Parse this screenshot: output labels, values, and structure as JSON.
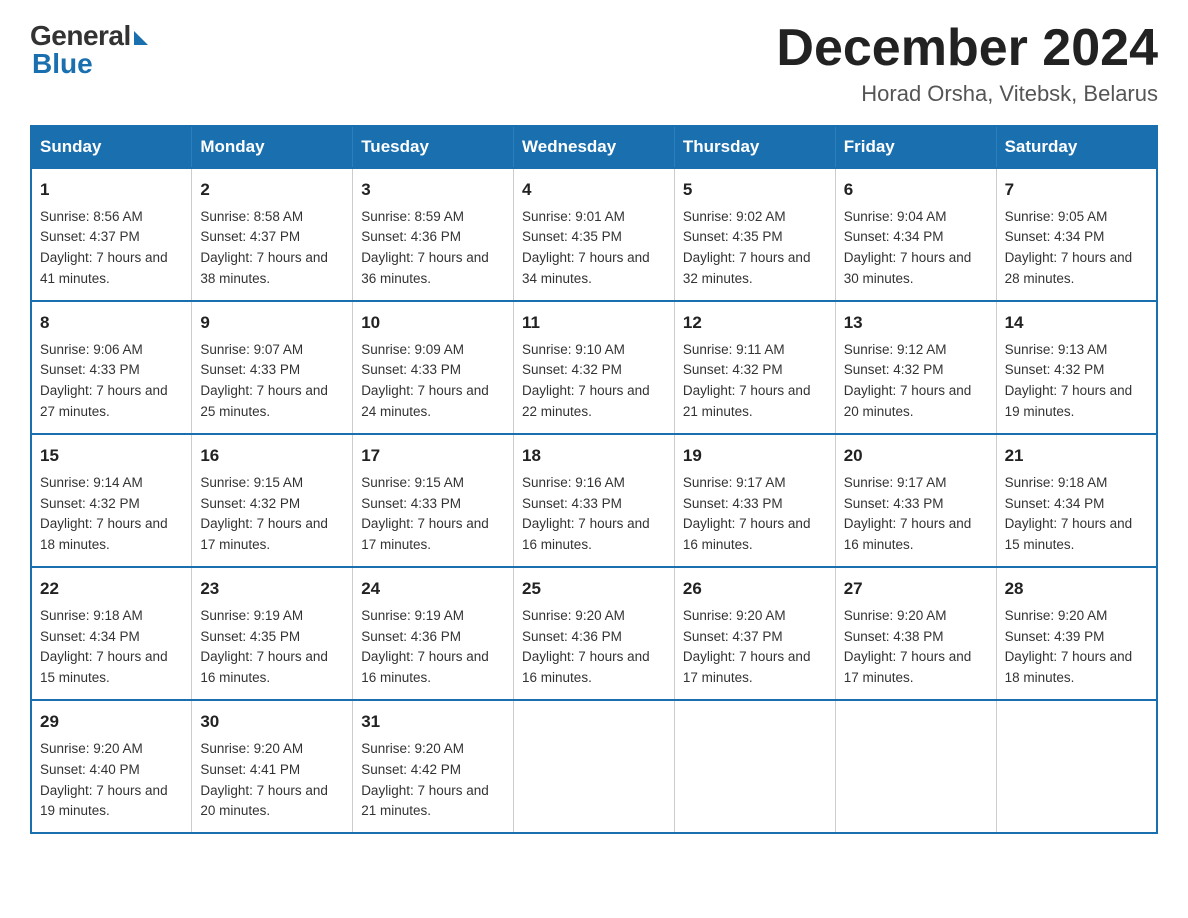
{
  "header": {
    "logo_general": "General",
    "logo_blue": "Blue",
    "month_title": "December 2024",
    "subtitle": "Horad Orsha, Vitebsk, Belarus"
  },
  "weekdays": [
    "Sunday",
    "Monday",
    "Tuesday",
    "Wednesday",
    "Thursday",
    "Friday",
    "Saturday"
  ],
  "weeks": [
    [
      {
        "day": "1",
        "sunrise": "8:56 AM",
        "sunset": "4:37 PM",
        "daylight": "7 hours and 41 minutes."
      },
      {
        "day": "2",
        "sunrise": "8:58 AM",
        "sunset": "4:37 PM",
        "daylight": "7 hours and 38 minutes."
      },
      {
        "day": "3",
        "sunrise": "8:59 AM",
        "sunset": "4:36 PM",
        "daylight": "7 hours and 36 minutes."
      },
      {
        "day": "4",
        "sunrise": "9:01 AM",
        "sunset": "4:35 PM",
        "daylight": "7 hours and 34 minutes."
      },
      {
        "day": "5",
        "sunrise": "9:02 AM",
        "sunset": "4:35 PM",
        "daylight": "7 hours and 32 minutes."
      },
      {
        "day": "6",
        "sunrise": "9:04 AM",
        "sunset": "4:34 PM",
        "daylight": "7 hours and 30 minutes."
      },
      {
        "day": "7",
        "sunrise": "9:05 AM",
        "sunset": "4:34 PM",
        "daylight": "7 hours and 28 minutes."
      }
    ],
    [
      {
        "day": "8",
        "sunrise": "9:06 AM",
        "sunset": "4:33 PM",
        "daylight": "7 hours and 27 minutes."
      },
      {
        "day": "9",
        "sunrise": "9:07 AM",
        "sunset": "4:33 PM",
        "daylight": "7 hours and 25 minutes."
      },
      {
        "day": "10",
        "sunrise": "9:09 AM",
        "sunset": "4:33 PM",
        "daylight": "7 hours and 24 minutes."
      },
      {
        "day": "11",
        "sunrise": "9:10 AM",
        "sunset": "4:32 PM",
        "daylight": "7 hours and 22 minutes."
      },
      {
        "day": "12",
        "sunrise": "9:11 AM",
        "sunset": "4:32 PM",
        "daylight": "7 hours and 21 minutes."
      },
      {
        "day": "13",
        "sunrise": "9:12 AM",
        "sunset": "4:32 PM",
        "daylight": "7 hours and 20 minutes."
      },
      {
        "day": "14",
        "sunrise": "9:13 AM",
        "sunset": "4:32 PM",
        "daylight": "7 hours and 19 minutes."
      }
    ],
    [
      {
        "day": "15",
        "sunrise": "9:14 AM",
        "sunset": "4:32 PM",
        "daylight": "7 hours and 18 minutes."
      },
      {
        "day": "16",
        "sunrise": "9:15 AM",
        "sunset": "4:32 PM",
        "daylight": "7 hours and 17 minutes."
      },
      {
        "day": "17",
        "sunrise": "9:15 AM",
        "sunset": "4:33 PM",
        "daylight": "7 hours and 17 minutes."
      },
      {
        "day": "18",
        "sunrise": "9:16 AM",
        "sunset": "4:33 PM",
        "daylight": "7 hours and 16 minutes."
      },
      {
        "day": "19",
        "sunrise": "9:17 AM",
        "sunset": "4:33 PM",
        "daylight": "7 hours and 16 minutes."
      },
      {
        "day": "20",
        "sunrise": "9:17 AM",
        "sunset": "4:33 PM",
        "daylight": "7 hours and 16 minutes."
      },
      {
        "day": "21",
        "sunrise": "9:18 AM",
        "sunset": "4:34 PM",
        "daylight": "7 hours and 15 minutes."
      }
    ],
    [
      {
        "day": "22",
        "sunrise": "9:18 AM",
        "sunset": "4:34 PM",
        "daylight": "7 hours and 15 minutes."
      },
      {
        "day": "23",
        "sunrise": "9:19 AM",
        "sunset": "4:35 PM",
        "daylight": "7 hours and 16 minutes."
      },
      {
        "day": "24",
        "sunrise": "9:19 AM",
        "sunset": "4:36 PM",
        "daylight": "7 hours and 16 minutes."
      },
      {
        "day": "25",
        "sunrise": "9:20 AM",
        "sunset": "4:36 PM",
        "daylight": "7 hours and 16 minutes."
      },
      {
        "day": "26",
        "sunrise": "9:20 AM",
        "sunset": "4:37 PM",
        "daylight": "7 hours and 17 minutes."
      },
      {
        "day": "27",
        "sunrise": "9:20 AM",
        "sunset": "4:38 PM",
        "daylight": "7 hours and 17 minutes."
      },
      {
        "day": "28",
        "sunrise": "9:20 AM",
        "sunset": "4:39 PM",
        "daylight": "7 hours and 18 minutes."
      }
    ],
    [
      {
        "day": "29",
        "sunrise": "9:20 AM",
        "sunset": "4:40 PM",
        "daylight": "7 hours and 19 minutes."
      },
      {
        "day": "30",
        "sunrise": "9:20 AM",
        "sunset": "4:41 PM",
        "daylight": "7 hours and 20 minutes."
      },
      {
        "day": "31",
        "sunrise": "9:20 AM",
        "sunset": "4:42 PM",
        "daylight": "7 hours and 21 minutes."
      },
      null,
      null,
      null,
      null
    ]
  ]
}
